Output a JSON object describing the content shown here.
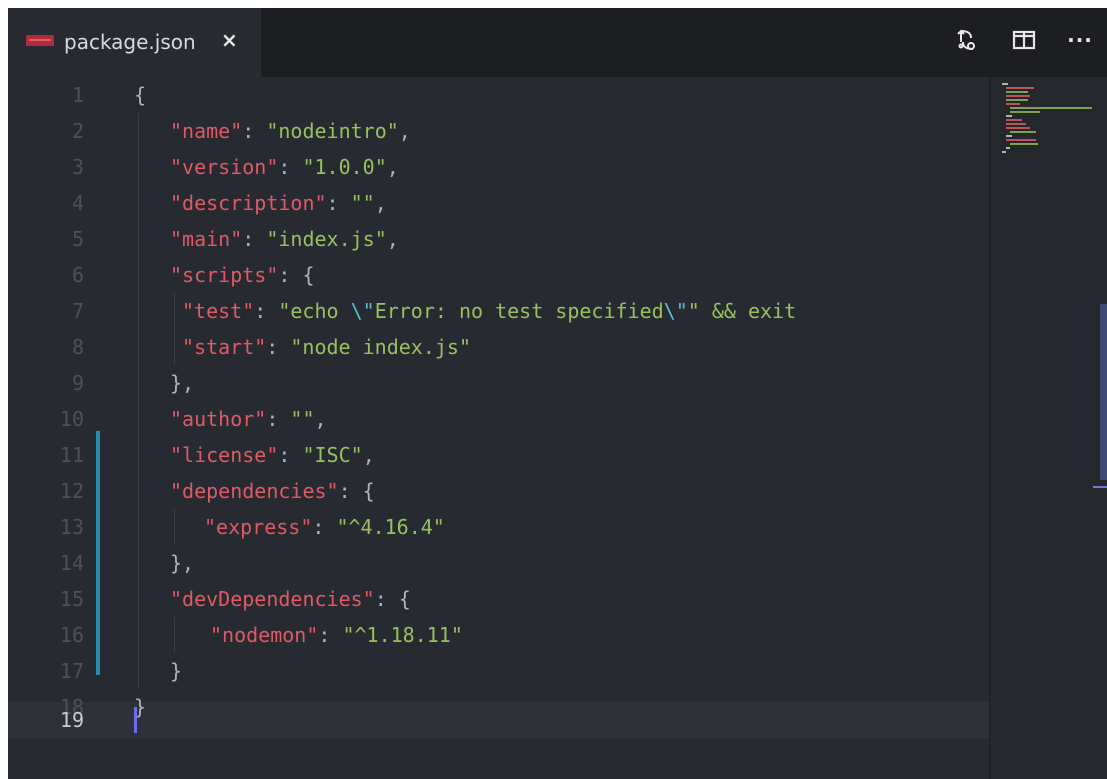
{
  "tab": {
    "title": "package.json",
    "close_label": "×",
    "icon": "json-file-icon"
  },
  "toolbar": {
    "icons": [
      "open-changes-icon",
      "split-editor-icon",
      "more-actions-icon"
    ],
    "more_label": "···"
  },
  "colors": {
    "key": "#e05a65",
    "string": "#97c15e",
    "punctuation": "#aeb3bc",
    "escape": "#5bbcd6",
    "git_modified": "#2a8cab",
    "cursor": "#6c6cf0",
    "background": "#272a30"
  },
  "editor": {
    "active_line": 19,
    "lines": [
      {
        "n": "1"
      },
      {
        "n": "2"
      },
      {
        "n": "3"
      },
      {
        "n": "4"
      },
      {
        "n": "5"
      },
      {
        "n": "6"
      },
      {
        "n": "7"
      },
      {
        "n": "8"
      },
      {
        "n": "9"
      },
      {
        "n": "10"
      },
      {
        "n": "11"
      },
      {
        "n": "12"
      },
      {
        "n": "13"
      },
      {
        "n": "14"
      },
      {
        "n": "15"
      },
      {
        "n": "16"
      },
      {
        "n": "17"
      },
      {
        "n": "18"
      },
      {
        "n": "19"
      }
    ],
    "code": {
      "l1": {
        "brace": "{"
      },
      "l2": {
        "key": "\"name\"",
        "colon": ": ",
        "val": "\"nodeintro\"",
        "end": ","
      },
      "l3": {
        "key": "\"version\"",
        "colon": ": ",
        "val": "\"1.0.0\"",
        "end": ","
      },
      "l4": {
        "key": "\"description\"",
        "colon": ": ",
        "val": "\"\"",
        "end": ","
      },
      "l5": {
        "key": "\"main\"",
        "colon": ": ",
        "val": "\"index.js\"",
        "end": ","
      },
      "l6": {
        "key": "\"scripts\"",
        "colon": ": ",
        "end": "{"
      },
      "l7": {
        "key": "\"test\"",
        "colon": ": ",
        "val_a": "\"echo ",
        "esc_a": "\\\"",
        "val_b": "Error: no test specified",
        "esc_b": "\\\"",
        "val_c": "\" && exit"
      },
      "l8": {
        "key": "\"start\"",
        "colon": ": ",
        "val": "\"node index.js\""
      },
      "l9": {
        "text": "},"
      },
      "l10": {
        "key": "\"author\"",
        "colon": ": ",
        "val": "\"\"",
        "end": ","
      },
      "l11": {
        "key": "\"license\"",
        "colon": ": ",
        "val": "\"ISC\"",
        "end": ","
      },
      "l12": {
        "key": "\"dependencies\"",
        "colon": ": ",
        "end": "{"
      },
      "l13": {
        "key": "\"express\"",
        "colon": ": ",
        "val": "\"^4.16.4\""
      },
      "l14": {
        "text": "},"
      },
      "l15": {
        "key": "\"devDependencies\"",
        "colon": ": ",
        "end": "{"
      },
      "l16": {
        "key": "\"nodemon\"",
        "colon": ": ",
        "val": "\"^1.18.11\""
      },
      "l17": {
        "text": "}"
      },
      "l18": {
        "text": "}"
      }
    }
  }
}
